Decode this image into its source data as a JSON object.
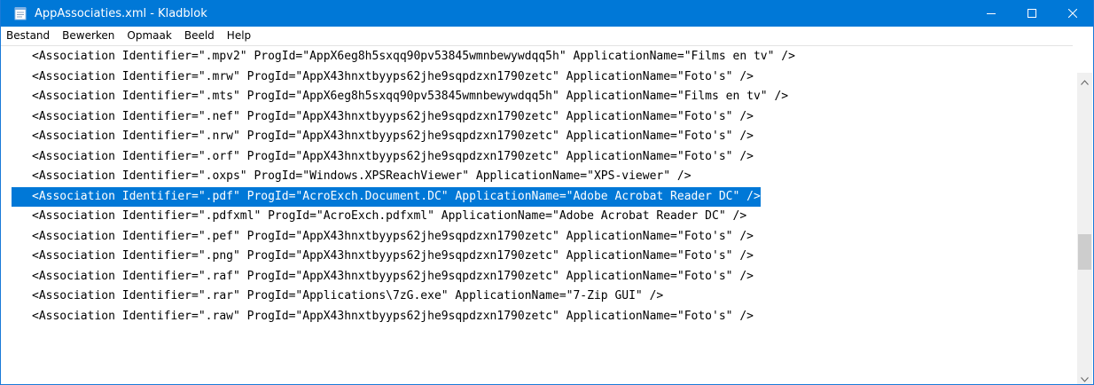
{
  "window": {
    "title": "AppAssociaties.xml - Kladblok",
    "accent_color": "#0078d7",
    "app_icon": "notepad-icon"
  },
  "caption_buttons": {
    "minimize_icon": "minimize-icon",
    "maximize_icon": "maximize-icon",
    "close_icon": "close-icon"
  },
  "menu": {
    "items": [
      "Bestand",
      "Bewerken",
      "Opmaak",
      "Beeld",
      "Help"
    ]
  },
  "editor": {
    "selected_line_index": 7,
    "selection_color": "#0078d7",
    "lines": [
      "<Association Identifier=\".mpv2\" ProgId=\"AppX6eg8h5sxqq90pv53845wmnbewywdqq5h\" ApplicationName=\"Films en tv\" />",
      "<Association Identifier=\".mrw\" ProgId=\"AppX43hnxtbyyps62jhe9sqpdzxn1790zetc\" ApplicationName=\"Foto's\" />",
      "<Association Identifier=\".mts\" ProgId=\"AppX6eg8h5sxqq90pv53845wmnbewywdqq5h\" ApplicationName=\"Films en tv\" />",
      "<Association Identifier=\".nef\" ProgId=\"AppX43hnxtbyyps62jhe9sqpdzxn1790zetc\" ApplicationName=\"Foto's\" />",
      "<Association Identifier=\".nrw\" ProgId=\"AppX43hnxtbyyps62jhe9sqpdzxn1790zetc\" ApplicationName=\"Foto's\" />",
      "<Association Identifier=\".orf\" ProgId=\"AppX43hnxtbyyps62jhe9sqpdzxn1790zetc\" ApplicationName=\"Foto's\" />",
      "<Association Identifier=\".oxps\" ProgId=\"Windows.XPSReachViewer\" ApplicationName=\"XPS-viewer\" />",
      "<Association Identifier=\".pdf\" ProgId=\"AcroExch.Document.DC\" ApplicationName=\"Adobe Acrobat Reader DC\" />",
      "<Association Identifier=\".pdfxml\" ProgId=\"AcroExch.pdfxml\" ApplicationName=\"Adobe Acrobat Reader DC\" />",
      "<Association Identifier=\".pef\" ProgId=\"AppX43hnxtbyyps62jhe9sqpdzxn1790zetc\" ApplicationName=\"Foto's\" />",
      "<Association Identifier=\".png\" ProgId=\"AppX43hnxtbyyps62jhe9sqpdzxn1790zetc\" ApplicationName=\"Foto's\" />",
      "<Association Identifier=\".raf\" ProgId=\"AppX43hnxtbyyps62jhe9sqpdzxn1790zetc\" ApplicationName=\"Foto's\" />",
      "<Association Identifier=\".rar\" ProgId=\"Applications\\7zG.exe\" ApplicationName=\"7-Zip GUI\" />",
      "<Association Identifier=\".raw\" ProgId=\"AppX43hnxtbyyps62jhe9sqpdzxn1790zetc\" ApplicationName=\"Foto's\" />"
    ]
  },
  "scrollbar": {
    "up_icon": "chevron-up-icon",
    "down_icon": "chevron-down-icon",
    "position_fraction": 0.55
  }
}
